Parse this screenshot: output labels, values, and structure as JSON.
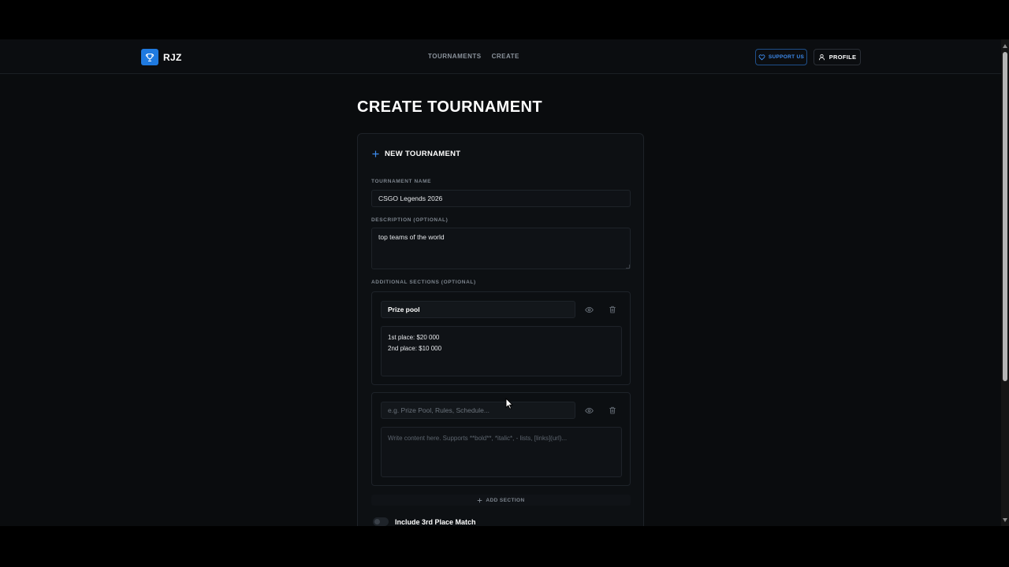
{
  "brand": {
    "name": "RJZ"
  },
  "nav": {
    "links": [
      "TOURNAMENTS",
      "CREATE"
    ]
  },
  "header_actions": {
    "support_label": "SUPPORT US",
    "profile_label": "PROFILE"
  },
  "page": {
    "title": "CREATE TOURNAMENT"
  },
  "form": {
    "header": "NEW TOURNAMENT",
    "name_label": "TOURNAMENT NAME",
    "name_value": "CSGO Legends 2026",
    "description_label": "DESCRIPTION (OPTIONAL)",
    "description_value": "top teams of the world",
    "sections_label": "ADDITIONAL SECTIONS (OPTIONAL)",
    "sections": [
      {
        "title_value": "Prize pool",
        "title_placeholder": "e.g. Prize Pool, Rules, Schedule...",
        "body_value": "1st place: $20 000\n2nd place: $10 000",
        "body_placeholder": "Write content here. Supports **bold**, *italic*, - lists, [links](url)..."
      },
      {
        "title_value": "",
        "title_placeholder": "e.g. Prize Pool, Rules, Schedule...",
        "body_value": "",
        "body_placeholder": "Write content here. Supports **bold**, *italic*, - lists, [links](url)..."
      }
    ],
    "add_section_label": "ADD SECTION",
    "third_place_label": "Include 3rd Place Match",
    "third_place_enabled": false
  },
  "icons": {
    "logo": "trophy-icon",
    "support": "heart-icon",
    "profile": "user-icon",
    "header": "plus-icon",
    "visibility": "eye-icon",
    "delete": "trash-icon",
    "add": "plus-icon"
  },
  "colors": {
    "background": "#0a0c0e",
    "accent": "#1f7ae0",
    "support_text": "#3d8cf0",
    "card": "#0d1013"
  }
}
